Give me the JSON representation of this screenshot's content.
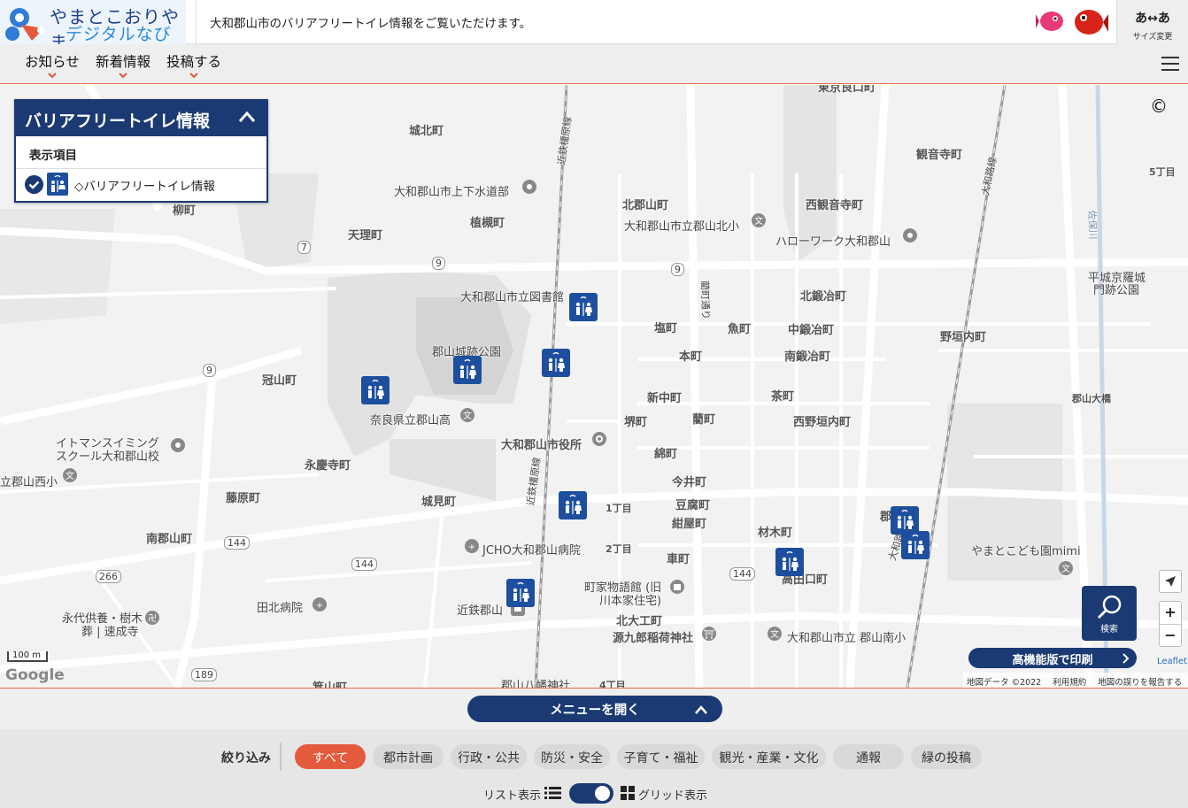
{
  "header": {
    "logo_line1": "やまとこおりやま",
    "logo_line2": "デジタルなび",
    "tagline": "大和郡山市のバリアフリートイレ情報をご覧いただけます。",
    "size_button_top": "あ↔あ",
    "size_button_label": "サイズ変更"
  },
  "nav": {
    "items": [
      {
        "label": "お知らせ"
      },
      {
        "label": "新着情報"
      },
      {
        "label": "投稿する"
      }
    ]
  },
  "legend": {
    "title": "バリアフリートイレ情報",
    "section": "表示項目",
    "item": "◇バリアフリートイレ情報"
  },
  "map": {
    "copyright_symbol": "©",
    "scale": "100 m",
    "google": "Google",
    "attribution": {
      "data": "地図データ ©2022",
      "terms": "利用規約",
      "report": "地図の誤りを報告する"
    },
    "leaflet": "Leaflet",
    "search_label": "検索",
    "print_label": "高機能版で印刷",
    "zoom_in": "+",
    "zoom_out": "−",
    "labels": [
      {
        "t": "東京良口町",
        "b": true
      },
      {
        "t": "城北町",
        "b": true
      },
      {
        "t": "観音寺町",
        "b": true
      },
      {
        "t": "5丁目",
        "b": true
      },
      {
        "t": "大和郡山市上下水道部",
        "b": false
      },
      {
        "t": "北郡山町",
        "b": true
      },
      {
        "t": "西観音寺町",
        "b": true
      },
      {
        "t": "柳町",
        "b": true
      },
      {
        "t": "植槻町",
        "b": true
      },
      {
        "t": "大和郡山市立郡山北小",
        "b": false
      },
      {
        "t": "天理町",
        "b": true
      },
      {
        "t": "ハローワーク大和郡山",
        "b": false
      },
      {
        "t": "平城京羅城",
        "b": false
      },
      {
        "t": "門跡公園",
        "b": false
      },
      {
        "t": "大和郡山市立図書館",
        "b": false
      },
      {
        "t": "北鍛冶町",
        "b": true
      },
      {
        "t": "塩町",
        "b": true
      },
      {
        "t": "魚町",
        "b": true
      },
      {
        "t": "中鍛冶町",
        "b": true
      },
      {
        "t": "野垣内町",
        "b": true
      },
      {
        "t": "郡山城跡公園",
        "b": false
      },
      {
        "t": "本町",
        "b": true
      },
      {
        "t": "南鍛冶町",
        "b": true
      },
      {
        "t": "冠山町",
        "b": true
      },
      {
        "t": "新中町",
        "b": true
      },
      {
        "t": "茶町",
        "b": true
      },
      {
        "t": "郡山大橋",
        "b": true
      },
      {
        "t": "奈良県立郡山高",
        "b": false
      },
      {
        "t": "堺町",
        "b": true
      },
      {
        "t": "藺町",
        "b": true
      },
      {
        "t": "西野垣内町",
        "b": true
      },
      {
        "t": "イトマンスイミング",
        "b": false
      },
      {
        "t": "スクール大和郡山校",
        "b": false
      },
      {
        "t": "大和郡山市役所",
        "b": true
      },
      {
        "t": "綿町",
        "b": true
      },
      {
        "t": "立郡山西小",
        "b": false
      },
      {
        "t": "永慶寺町",
        "b": true
      },
      {
        "t": "今井町",
        "b": true
      },
      {
        "t": "藤原町",
        "b": true
      },
      {
        "t": "城見町",
        "b": true
      },
      {
        "t": "1丁目",
        "b": true
      },
      {
        "t": "豆腐町",
        "b": true
      },
      {
        "t": "紺屋町",
        "b": true
      },
      {
        "t": "材木町",
        "b": true
      },
      {
        "t": "やまとこども園mimi",
        "b": false
      },
      {
        "t": "南郡山町",
        "b": true
      },
      {
        "t": "JCHO大和郡山病院",
        "b": false
      },
      {
        "t": "2丁目",
        "b": true
      },
      {
        "t": "車町",
        "b": true
      },
      {
        "t": "高田口町",
        "b": true
      },
      {
        "t": "町家物語館 (旧",
        "b": false
      },
      {
        "t": "川本家住宅)",
        "b": false
      },
      {
        "t": "田北病院",
        "b": false
      },
      {
        "t": "近鉄郡山",
        "b": false
      },
      {
        "t": "永代供養・樹木",
        "b": false
      },
      {
        "t": "葬 | 速成寺",
        "b": false
      },
      {
        "t": "北大工町",
        "b": true
      },
      {
        "t": "源九郎稲荷神社",
        "b": true
      },
      {
        "t": "大和郡山市立 郡山南小",
        "b": false
      },
      {
        "t": "箕山町",
        "b": true
      },
      {
        "t": "郡山八幡神社",
        "b": false
      },
      {
        "t": "4丁目",
        "b": true
      },
      {
        "t": "近鉄橿原線",
        "b": false
      },
      {
        "t": "近鉄橿原線",
        "b": false
      },
      {
        "t": "大和路線",
        "b": false
      },
      {
        "t": "大和路線",
        "b": false
      },
      {
        "t": "藺町通り",
        "b": false
      },
      {
        "t": "佐保川",
        "b": false
      },
      {
        "t": "郡",
        "b": true
      }
    ],
    "route_numbers": [
      "7",
      "9",
      "9",
      "9",
      "144",
      "144",
      "144",
      "266",
      "189"
    ]
  },
  "footer": {
    "menu_button": "メニューを開く",
    "filter_label": "絞り込み",
    "chips": [
      "すべて",
      "都市計画",
      "行政・公共",
      "防災・安全",
      "子育て・福祉",
      "観光・産業・文化",
      "通報",
      "緑の投稿"
    ],
    "list_label": "リスト表示",
    "grid_label": "グリッド表示"
  },
  "colors": {
    "primary": "#1b3a73",
    "accent": "#e45a3c",
    "map_bg": "#f2f2f2"
  }
}
